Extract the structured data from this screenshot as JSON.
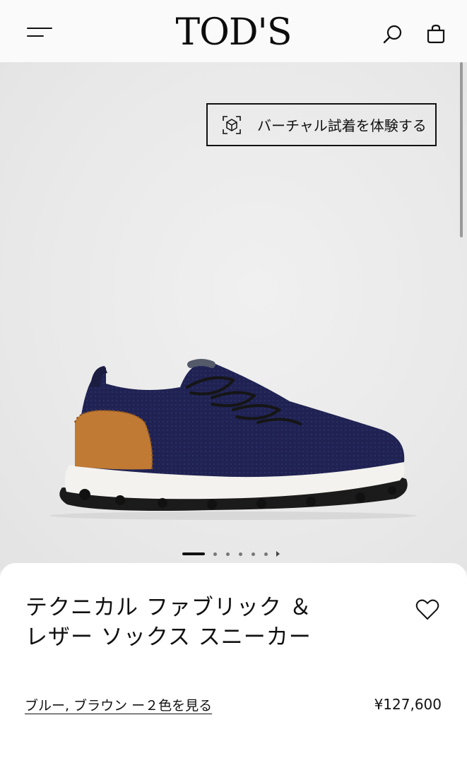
{
  "header": {
    "logo": "TOD'S",
    "menu_icon": "hamburger-menu-icon",
    "search_icon": "search-icon",
    "bag_icon": "shopping-bag-icon"
  },
  "hero": {
    "virtual_tryon_label": "バーチャル試着を体験する",
    "virtual_tryon_icon": "ar-cube-icon",
    "product_image": "navy knit sneaker with tan leather heel and white sole",
    "carousel": {
      "total_dots": 6,
      "active_index": 0,
      "has_next_arrow": true
    }
  },
  "product": {
    "title": "テクニカル ファブリック ＆レザー ソックス スニーカー",
    "colors_link": "ブルー, ブラウン ー２色を見る",
    "price": "¥127,600",
    "wishlist_icon": "heart-icon"
  },
  "colors": {
    "shoe_body": "#1e2150",
    "shoe_heel": "#c07a33",
    "sole": "#f4f2ee",
    "tread": "#1a1a1a"
  }
}
